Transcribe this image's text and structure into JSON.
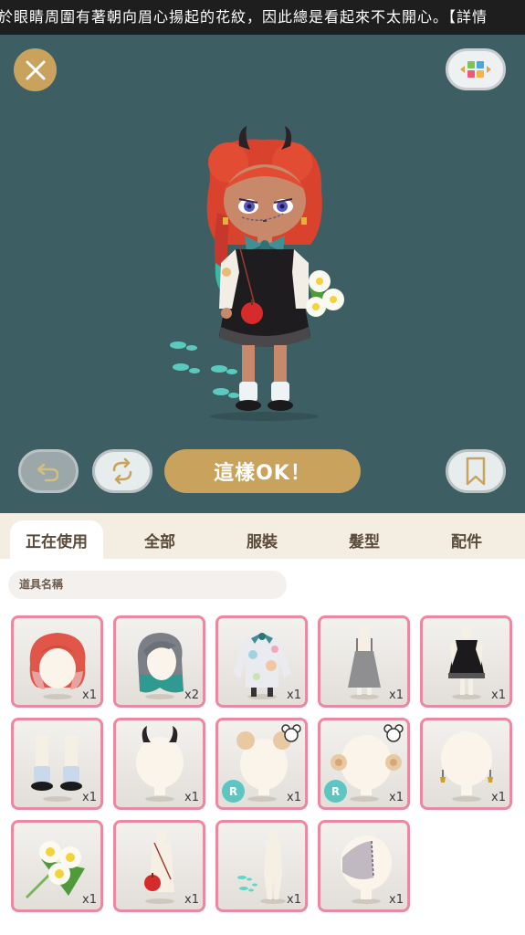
{
  "marquee_text": "於眼睛周圍有著朝向眉心揚起的花紋，因此總是看起來不太開心。【詳情",
  "toolbar": {
    "ok_label": "這樣OK！"
  },
  "tabs": [
    {
      "label": "正在使用",
      "active": true
    },
    {
      "label": "全部",
      "active": false
    },
    {
      "label": "服裝",
      "active": false
    },
    {
      "label": "髮型",
      "active": false
    },
    {
      "label": "配件",
      "active": false
    }
  ],
  "search": {
    "placeholder": "道具名稱"
  },
  "items": [
    {
      "name": "red-wavy-hair",
      "qty": "x1"
    },
    {
      "name": "gray-teal-gradient-hair",
      "qty": "x2"
    },
    {
      "name": "pastel-jacket",
      "qty": "x1"
    },
    {
      "name": "gray-slip-dress",
      "qty": "x1"
    },
    {
      "name": "black-dress",
      "qty": "x1"
    },
    {
      "name": "socks-shoes",
      "qty": "x1"
    },
    {
      "name": "black-horns",
      "qty": "x1"
    },
    {
      "name": "hair-buns",
      "qty": "x1",
      "badge": "R"
    },
    {
      "name": "curled-buns",
      "qty": "x1",
      "badge": "R"
    },
    {
      "name": "bell-earrings",
      "qty": "x1"
    },
    {
      "name": "flower-bouquet",
      "qty": "x1"
    },
    {
      "name": "apple-pouch",
      "qty": "x1"
    },
    {
      "name": "footprint-effect",
      "qty": "x1"
    },
    {
      "name": "stitched-face",
      "qty": "x1"
    }
  ],
  "colors": {
    "accent": "#c9a35e",
    "stage_bg": "#3d5f63",
    "item_border": "#e98aa0",
    "tab_bar": "#f4ede2",
    "badge_r": "#5cc6c2"
  }
}
